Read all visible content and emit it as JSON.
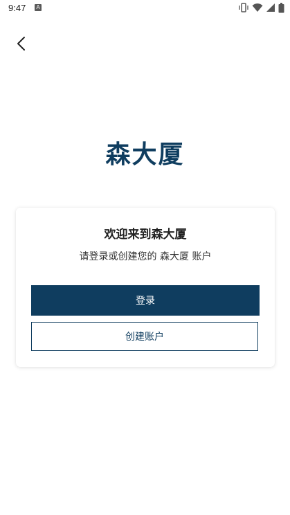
{
  "status_bar": {
    "time": "9:47",
    "notification_glyph": "A",
    "icons": [
      "vibrate-icon",
      "wifi-icon",
      "signal-icon",
      "battery-icon"
    ]
  },
  "nav": {
    "back_icon": "chevron-left-icon"
  },
  "brand": {
    "logo_text": "森大厦",
    "color": "#0f3d5f"
  },
  "card": {
    "title": "欢迎来到森大厦",
    "subtitle": "请登录或创建您的 森大厦 账户",
    "login_label": "登录",
    "create_label": "创建账户"
  },
  "colors": {
    "primary": "#0f3d5f",
    "background": "#ffffff"
  }
}
